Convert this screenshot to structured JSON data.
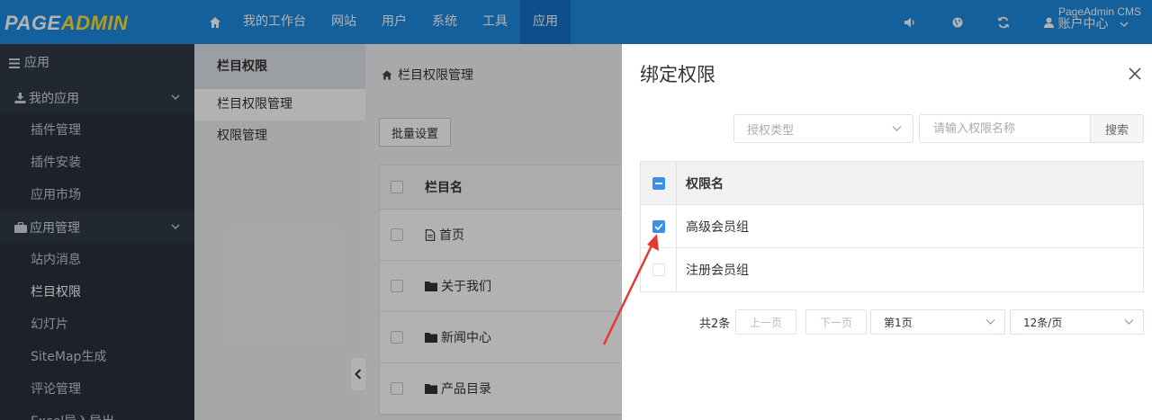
{
  "brand": {
    "part1": "PAGE",
    "part2": "ADMIN"
  },
  "watermark": "PageAdmin CMS",
  "topnav": {
    "home_icon": "home-icon",
    "items": [
      "我的工作台",
      "网站",
      "用户",
      "系统",
      "工具",
      "应用"
    ],
    "active": "应用",
    "right_icons": [
      "volume-icon",
      "globe-icon",
      "refresh-icon"
    ],
    "account_label": "账户中心"
  },
  "sidebar": {
    "header": "应用",
    "groups": [
      {
        "label": "我的应用",
        "items": [
          "插件管理",
          "插件安装",
          "应用市场"
        ]
      },
      {
        "label": "应用管理",
        "items": [
          "站内消息",
          "栏目权限",
          "幻灯片",
          "SiteMap生成",
          "评论管理",
          "Excel导入导出"
        ]
      }
    ],
    "active_item": "栏目权限"
  },
  "submenu": {
    "title": "栏目权限",
    "items": [
      "栏目权限管理",
      "权限管理"
    ],
    "active": "栏目权限管理"
  },
  "main": {
    "breadcrumb": "栏目权限管理",
    "batch_button": "批量设置",
    "table": {
      "column_header": "栏目名",
      "rows": [
        {
          "name": "首页",
          "icon": "file-icon"
        },
        {
          "name": "关于我们",
          "icon": "folder-icon"
        },
        {
          "name": "新闻中心",
          "icon": "folder-icon"
        },
        {
          "name": "产品目录",
          "icon": "folder-icon"
        }
      ]
    }
  },
  "drawer": {
    "title": "绑定权限",
    "type_select_placeholder": "授权类型",
    "search_placeholder": "请输入权限名称",
    "search_button": "搜索",
    "table": {
      "column_header": "权限名",
      "rows": [
        {
          "name": "高级会员组",
          "checked": true
        },
        {
          "name": "注册会员组",
          "checked": false
        }
      ]
    },
    "pagination": {
      "total": "共2条",
      "prev": "上一页",
      "next": "下一页",
      "page_select": "第1页",
      "size_select": "12条/页"
    }
  },
  "colors": {
    "topbar": "#1e8ae0",
    "topbar_active": "#1370c7",
    "sidebar": "#323a48",
    "checkbox_blue": "#3d8ee6",
    "annotation_arrow": "#e53935"
  }
}
